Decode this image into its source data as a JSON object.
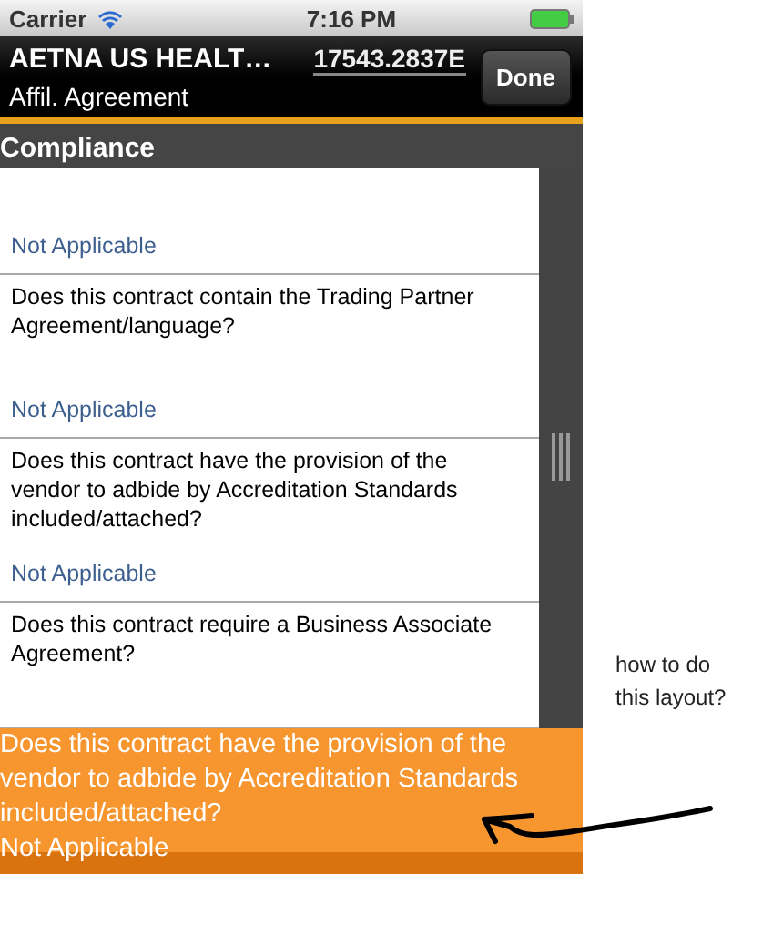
{
  "status_bar": {
    "carrier": "Carrier",
    "time": "7:16 PM"
  },
  "nav_bar": {
    "title": "AETNA US HEALT…",
    "code": "17543.2837E",
    "subtitle": "Affil. Agreement",
    "button": "Done"
  },
  "section": {
    "title": "Compliance"
  },
  "rows": [
    {
      "answer": "Not Applicable"
    },
    {
      "question": "Does this contract contain the Trading Partner Agreement/language?",
      "answer": "Not Applicable"
    },
    {
      "question": "Does this contract have the provision of the vendor to adbide by Accreditation Standards included/attached?",
      "answer": "Not Applicable"
    },
    {
      "question": "Does this contract require a Business Associate Agreement?"
    }
  ],
  "overlay": {
    "question": "Does this contract have the provision of the vendor to adbide by Accreditation Standards included/attached?",
    "answer": "Not Applicable"
  },
  "annotation": {
    "text": "how to do this layout?"
  }
}
